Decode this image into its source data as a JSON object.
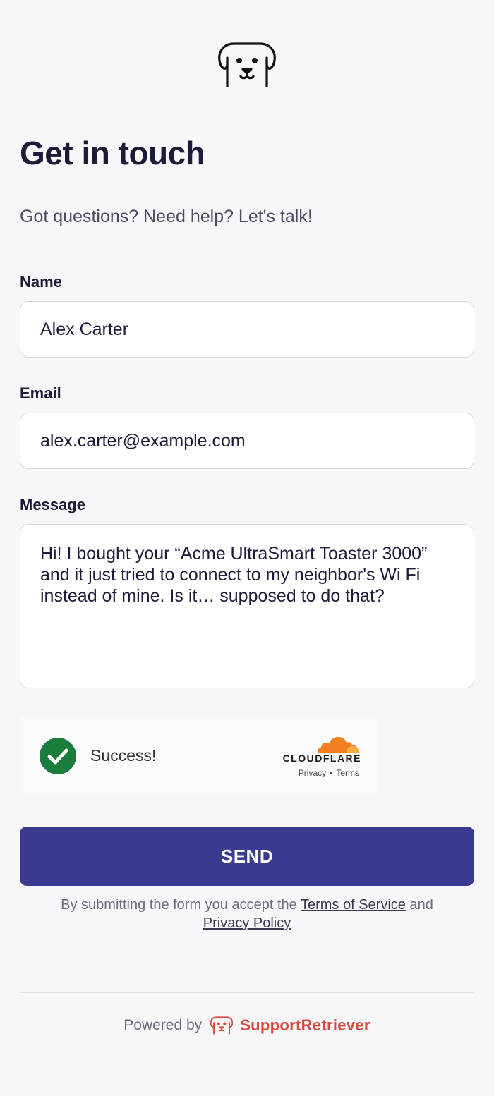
{
  "header": {
    "logo_icon": "dog-face-icon",
    "title": "Get in touch",
    "subtitle": "Got questions? Need help? Let's talk!"
  },
  "form": {
    "name": {
      "label": "Name",
      "value": "Alex Carter"
    },
    "email": {
      "label": "Email",
      "value": "alex.carter@example.com"
    },
    "message": {
      "label": "Message",
      "value": "Hi! I bought your “Acme UltraSmart Toaster 3000” and it just tried to connect to my neighbor's Wi Fi instead of mine. Is it… supposed to do that?"
    },
    "captcha": {
      "status": "Success!",
      "status_icon": "check-circle-icon",
      "provider": "CLOUDFLARE",
      "privacy_link": "Privacy",
      "terms_link": "Terms"
    },
    "submit_label": "SEND",
    "terms_text_before": "By submitting the form you accept the",
    "terms_of_service_link": "Terms of Service",
    "terms_text_and": "and",
    "privacy_policy_link": "Privacy Policy"
  },
  "footer": {
    "powered_by": "Powered by",
    "brand": "SupportRetriever",
    "brand_icon": "dog-face-icon"
  },
  "colors": {
    "background": "#f7f7fa",
    "primary": "#3a3a91",
    "brand": "#d64a3c",
    "success": "#1a7d3c",
    "cloudflare": "#f38020"
  }
}
